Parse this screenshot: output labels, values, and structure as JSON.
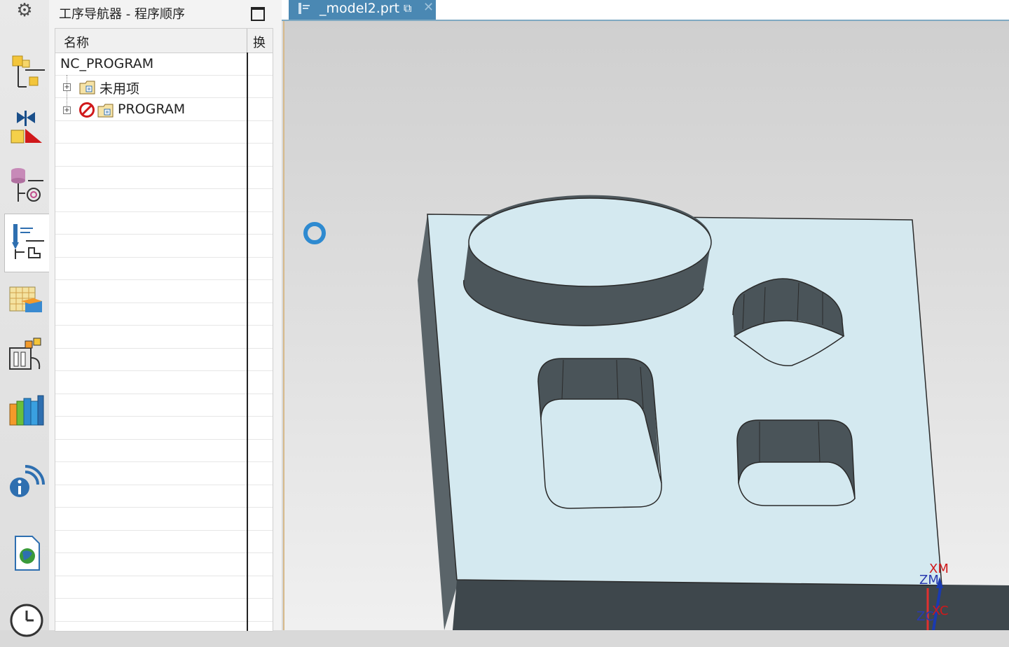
{
  "nav": {
    "title": "工序导航器 - 程序顺序",
    "col_name": "名称",
    "col_second": "换",
    "rows": [
      {
        "label": "NC_PROGRAM"
      },
      {
        "label": "未用项"
      },
      {
        "label": "PROGRAM"
      }
    ]
  },
  "tab": {
    "label": "_model2.prt"
  },
  "triad": {
    "xm": "XM",
    "zm": "ZM",
    "zc": "ZC",
    "xc": "XC"
  },
  "icons": [
    "gear-icon",
    "machine-tool-navigator-icon",
    "part-navigator-icon",
    "assembly-navigator-icon",
    "operation-navigator-icon",
    "reuse-library-icon",
    "hd3d-tools-icon",
    "roles-icon",
    "information-icon",
    "web-browser-icon",
    "history-icon",
    "busy-spinner-icon"
  ],
  "colors": {
    "part_face": "#d4e9f0",
    "part_wall": "#4a5358",
    "tab_active": "#4a88b3",
    "accent_red": "#d0191b"
  }
}
